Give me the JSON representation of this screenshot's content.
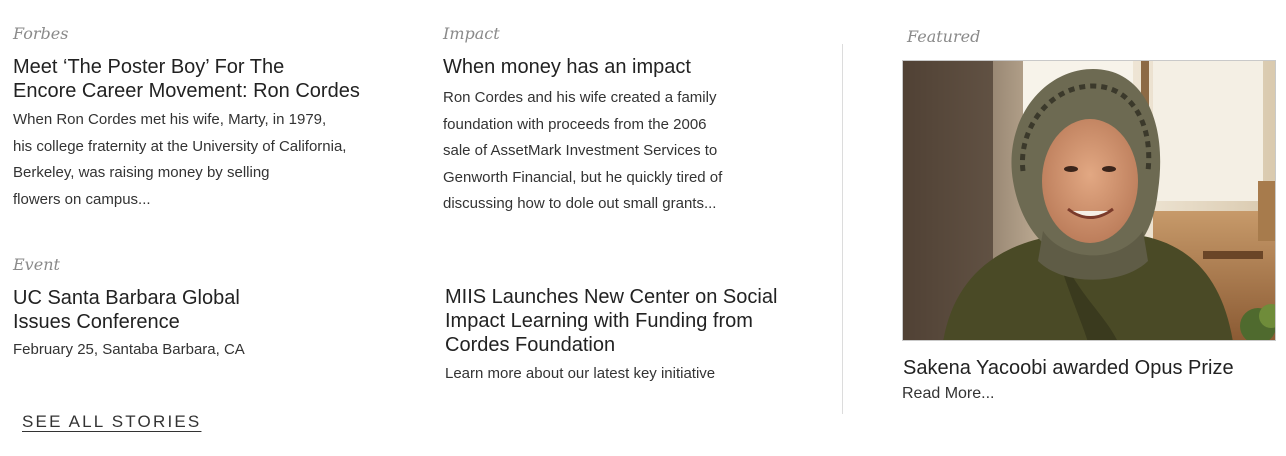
{
  "stories": [
    {
      "kicker": "Forbes",
      "headline_lines": [
        "Meet ‘The Poster Boy’ For The",
        "Encore Career Movement: Ron Cordes"
      ],
      "body_lines": [
        "When Ron Cordes met his wife, Marty, in 1979,",
        "his college fraternity at the University of California,",
        "Berkeley, was raising money by selling",
        "flowers on campus..."
      ]
    },
    {
      "kicker": "Impact",
      "headline_lines": [
        "When money has an impact"
      ],
      "body_lines": [
        "Ron Cordes and his wife created a family",
        "foundation with proceeds from the 2006",
        "sale of AssetMark Investment Services to",
        "Genworth Financial, but he quickly tired of",
        "discussing how to dole out small grants..."
      ]
    },
    {
      "kicker": "Event",
      "headline_lines": [
        "UC Santa Barbara Global",
        "Issues Conference"
      ],
      "body_lines": [
        "February 25, Santaba Barbara, CA"
      ]
    },
    {
      "kicker": "",
      "headline_lines": [
        "MIIS Launches New Center on Social",
        "Impact Learning with Funding from",
        "Cordes Foundation"
      ],
      "body_lines": [
        "Learn more about our latest key initiative"
      ]
    }
  ],
  "featured": {
    "kicker": "Featured",
    "headline": "Sakena Yacoobi awarded Opus Prize",
    "read_more": "Read More..."
  },
  "see_all_label": "SEE ALL STORIES"
}
